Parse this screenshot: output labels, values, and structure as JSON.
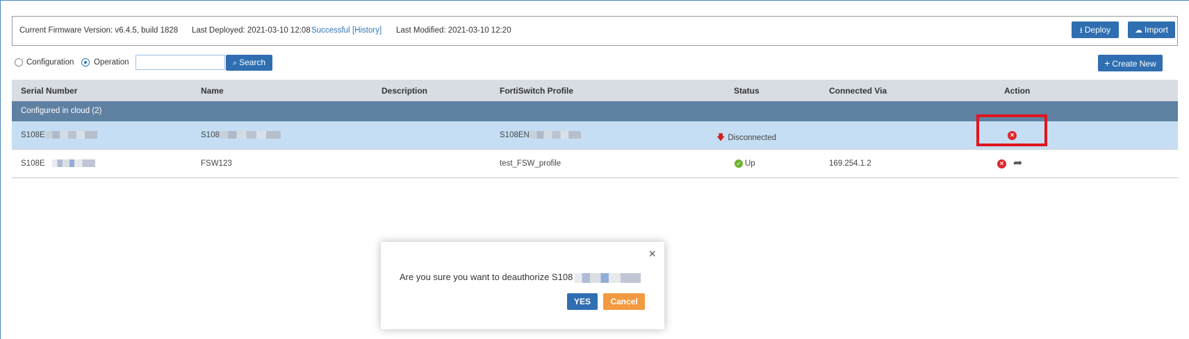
{
  "info_bar": {
    "firmware_label": "Current Firmware Version: v6.4.5, build 1828",
    "deployed_label": "Last Deployed: 2021-03-10 12:08",
    "deployed_status": "Successful",
    "history_link": "[History]",
    "modified_label": "Last Modified: 2021-03-10 12:20",
    "deploy_button": "Deploy",
    "import_button": "Import"
  },
  "toolbar": {
    "radio_configuration": "Configuration",
    "radio_operation": "Operation",
    "selected_mode": "Operation",
    "search_value": "",
    "search_button": "Search",
    "create_button": "Create New"
  },
  "table": {
    "columns": [
      "Serial Number",
      "Name",
      "Description",
      "FortiSwitch Profile",
      "Status",
      "Connected Via",
      "Action"
    ],
    "group_label": "Configured in cloud (2)",
    "rows": [
      {
        "serial": "S108E",
        "name": "S108",
        "description": "",
        "profile": "S108EN",
        "status": "Disconnected",
        "connected_via": "",
        "actions": [
          "deauthorize"
        ]
      },
      {
        "serial": "S108E",
        "name": "FSW123",
        "description": "",
        "profile": "test_FSW_profile",
        "status": "Up",
        "connected_via": "169.254.1.2",
        "actions": [
          "deauthorize",
          "goto"
        ]
      }
    ]
  },
  "dialog": {
    "message": "Are you sure you want to deauthorize S108",
    "yes_button": "YES",
    "cancel_button": "Cancel",
    "close_icon": "×"
  },
  "colors": {
    "accent": "#2f6eb0",
    "group_header": "#5e81a2",
    "selected_row": "#c5def3",
    "danger": "#e0262c",
    "ok": "#6eb22d",
    "cancel": "#f39a40",
    "highlight": "#e0161d"
  }
}
